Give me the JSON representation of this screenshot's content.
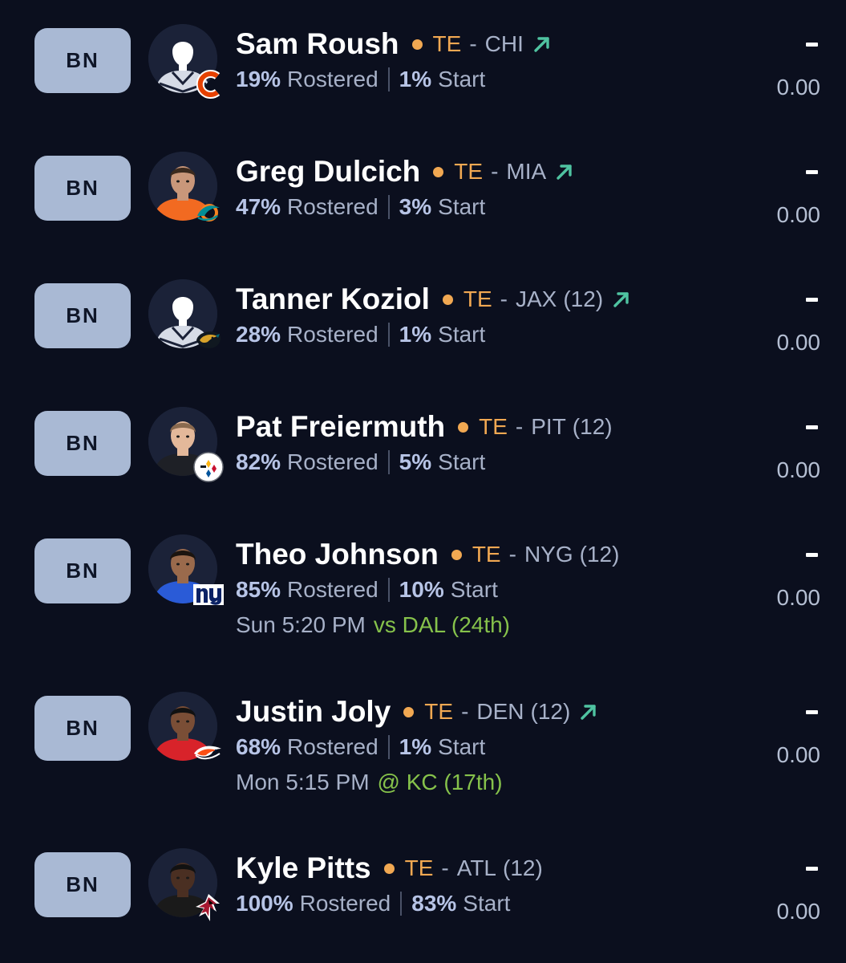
{
  "roster": {
    "players": [
      {
        "slot": "BN",
        "name": "Sam Roush",
        "position": "TE",
        "separator": "-",
        "team": "CHI",
        "bye": "",
        "trend_icon": "trending-up-icon",
        "rostered_pct": "19%",
        "rostered_label": "Rostered",
        "start_pct": "1%",
        "start_label": "Start",
        "game_time": "",
        "opponent": "",
        "proj_dash": "-",
        "proj_value": "0.00",
        "team_logo": "bears-logo",
        "avatar": "silhouette"
      },
      {
        "slot": "BN",
        "name": "Greg Dulcich",
        "position": "TE",
        "separator": "-",
        "team": "MIA",
        "bye": "",
        "trend_icon": "trending-up-icon",
        "rostered_pct": "47%",
        "rostered_label": "Rostered",
        "start_pct": "3%",
        "start_label": "Start",
        "game_time": "",
        "opponent": "",
        "proj_dash": "-",
        "proj_value": "0.00",
        "team_logo": "dolphins-logo",
        "avatar": "photo"
      },
      {
        "slot": "BN",
        "name": "Tanner Koziol",
        "position": "TE",
        "separator": "-",
        "team": "JAX",
        "bye": "(12)",
        "trend_icon": "trending-up-icon",
        "rostered_pct": "28%",
        "rostered_label": "Rostered",
        "start_pct": "1%",
        "start_label": "Start",
        "game_time": "",
        "opponent": "",
        "proj_dash": "-",
        "proj_value": "0.00",
        "team_logo": "jaguars-logo",
        "avatar": "silhouette"
      },
      {
        "slot": "BN",
        "name": "Pat Freiermuth",
        "position": "TE",
        "separator": "-",
        "team": "PIT",
        "bye": "(12)",
        "trend_icon": "",
        "rostered_pct": "82%",
        "rostered_label": "Rostered",
        "start_pct": "5%",
        "start_label": "Start",
        "game_time": "",
        "opponent": "",
        "proj_dash": "-",
        "proj_value": "0.00",
        "team_logo": "steelers-logo",
        "avatar": "photo"
      },
      {
        "slot": "BN",
        "name": "Theo Johnson",
        "position": "TE",
        "separator": "-",
        "team": "NYG",
        "bye": "(12)",
        "trend_icon": "",
        "rostered_pct": "85%",
        "rostered_label": "Rostered",
        "start_pct": "10%",
        "start_label": "Start",
        "game_time": "Sun 5:20 PM",
        "opponent": "vs DAL (24th)",
        "proj_dash": "-",
        "proj_value": "0.00",
        "team_logo": "giants-logo",
        "avatar": "photo"
      },
      {
        "slot": "BN",
        "name": "Justin Joly",
        "position": "TE",
        "separator": "-",
        "team": "DEN",
        "bye": "(12)",
        "trend_icon": "trending-up-icon",
        "rostered_pct": "68%",
        "rostered_label": "Rostered",
        "start_pct": "1%",
        "start_label": "Start",
        "game_time": "Mon 5:15 PM",
        "opponent": "@ KC (17th)",
        "proj_dash": "-",
        "proj_value": "0.00",
        "team_logo": "broncos-logo",
        "avatar": "photo"
      },
      {
        "slot": "BN",
        "name": "Kyle Pitts",
        "position": "TE",
        "separator": "-",
        "team": "ATL",
        "bye": "(12)",
        "trend_icon": "",
        "rostered_pct": "100%",
        "rostered_label": "Rostered",
        "start_pct": "83%",
        "start_label": "Start",
        "game_time": "",
        "opponent": "",
        "proj_dash": "-",
        "proj_value": "0.00",
        "team_logo": "falcons-logo",
        "avatar": "photo"
      }
    ]
  },
  "colors": {
    "background": "#0b0f1e",
    "slot_button": "#a9b9d4",
    "position": "#f1a852",
    "trend": "#4fc3a1",
    "opponent": "#86c24b",
    "secondary_text": "#a7b1c8"
  }
}
